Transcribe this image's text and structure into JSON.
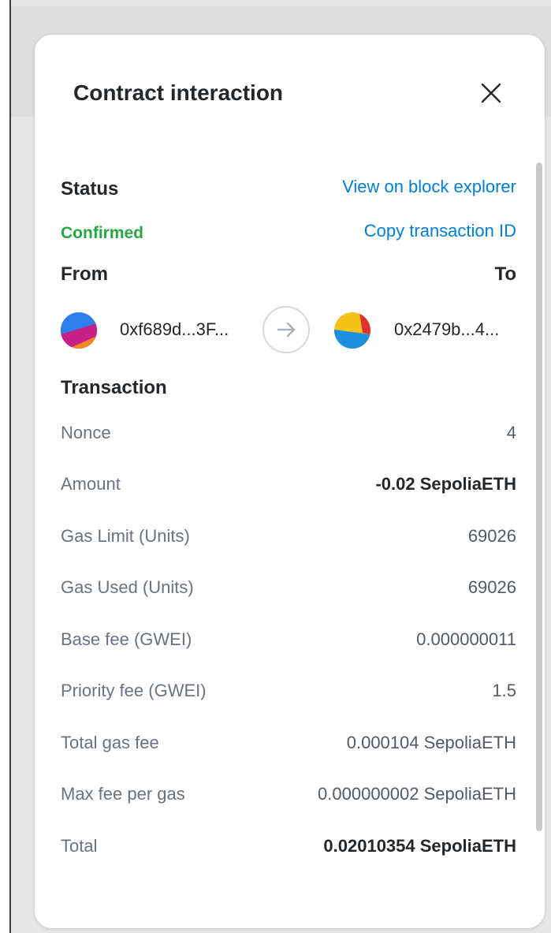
{
  "modal": {
    "title": "Contract interaction"
  },
  "status": {
    "label": "Status",
    "value": "Confirmed",
    "value_color": "#28a745",
    "explorer_link": "View on block explorer",
    "copy_link": "Copy transaction ID"
  },
  "parties": {
    "from_label": "From",
    "to_label": "To",
    "from_address": "0xf689d...3F...",
    "to_address": "0x2479b...4..."
  },
  "transaction": {
    "heading": "Transaction",
    "rows": [
      {
        "label": "Nonce",
        "value": "4"
      },
      {
        "label": "Amount",
        "value": "-0.02 SepoliaETH"
      },
      {
        "label": "Gas Limit (Units)",
        "value": "69026"
      },
      {
        "label": "Gas Used (Units)",
        "value": "69026"
      },
      {
        "label": "Base fee (GWEI)",
        "value": "0.000000011"
      },
      {
        "label": "Priority fee (GWEI)",
        "value": "1.5"
      },
      {
        "label": "Total gas fee",
        "value": "0.000104 SepoliaETH"
      },
      {
        "label": "Max fee per gas",
        "value": "0.000000002 SepoliaETH"
      },
      {
        "label": "Total",
        "value": "0.02010354 SepoliaETH"
      }
    ]
  },
  "colors": {
    "link": "#037dd6",
    "confirmed": "#28a745",
    "text_primary": "#24272a",
    "text_secondary": "#6a737d"
  }
}
